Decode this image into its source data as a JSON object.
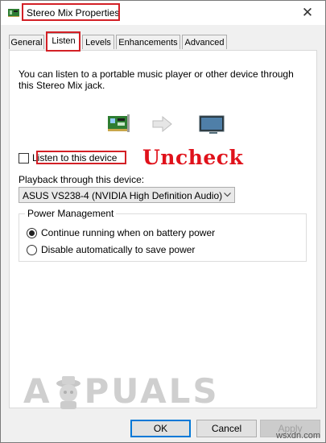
{
  "window": {
    "title": "Stereo Mix Properties",
    "close_glyph": "✕"
  },
  "tabs": [
    {
      "label": "General"
    },
    {
      "label": "Listen"
    },
    {
      "label": "Levels"
    },
    {
      "label": "Enhancements"
    },
    {
      "label": "Advanced"
    }
  ],
  "listen": {
    "description_line1": "You can listen to a portable music player or other device through",
    "description_line2": "this Stereo Mix jack.",
    "checkbox_label": "Listen to this device",
    "checkbox_checked": false,
    "playback_label": "Playback through this device:",
    "playback_value": "ASUS VS238-4 (NVIDIA High Definition Audio)",
    "power_group_label": "Power Management",
    "radio_continue": "Continue running when on battery power",
    "radio_disable": "Disable automatically to save power",
    "selected_power_option": "continue"
  },
  "annotation": {
    "text": "Uncheck",
    "color": "#e0121b"
  },
  "watermark": {
    "left": "A",
    "right": "PUALS"
  },
  "buttons": {
    "ok": "OK",
    "cancel": "Cancel",
    "apply": "Apply"
  },
  "site": "wsxdn.com",
  "colors": {
    "highlight": "#d32026",
    "accent": "#0078d7"
  }
}
